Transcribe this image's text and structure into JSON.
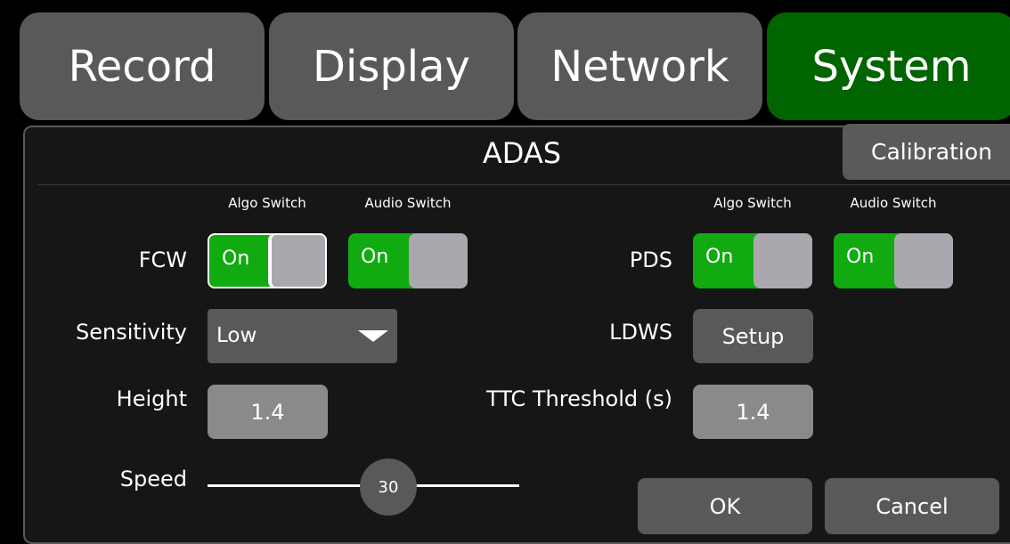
{
  "tabs": [
    {
      "label": "Record",
      "active": false
    },
    {
      "label": "Display",
      "active": false
    },
    {
      "label": "Network",
      "active": false
    },
    {
      "label": "System",
      "active": true
    }
  ],
  "panel": {
    "title": "ADAS",
    "calibration_label": "Calibration",
    "column_headers": {
      "left_algo": "Algo Switch",
      "left_audio": "Audio Switch",
      "right_algo": "Algo Switch",
      "right_audio": "Audio Switch"
    },
    "fcw": {
      "label": "FCW",
      "algo_switch": "On",
      "audio_switch": "On"
    },
    "pds": {
      "label": "PDS",
      "algo_switch": "On",
      "audio_switch": "On"
    },
    "sensitivity": {
      "label": "Sensitivity",
      "value": "Low"
    },
    "ldws": {
      "label": "LDWS",
      "button_label": "Setup"
    },
    "height": {
      "label": "Height",
      "value": "1.4"
    },
    "ttc": {
      "label": "TTC Threshold (s)",
      "value": "1.4"
    },
    "speed": {
      "label": "Speed",
      "value": "30"
    },
    "ok_label": "OK",
    "cancel_label": "Cancel"
  },
  "colors": {
    "active_tab": "#006400",
    "toggle_on": "#11aa11",
    "control_gray": "#595959"
  }
}
